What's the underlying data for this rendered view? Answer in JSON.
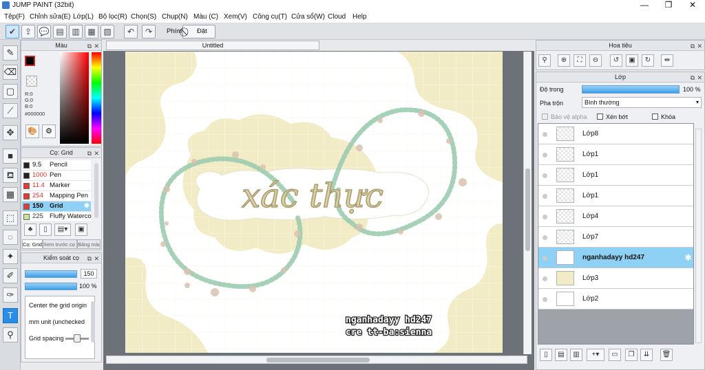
{
  "app": {
    "title": "JUMP PAINT (32bit)"
  },
  "window_controls": {
    "minimize": "—",
    "maximize": "❐",
    "close": "✕"
  },
  "menu": [
    "Tệp(F)",
    "Chỉnh sửa(E)",
    "Lớp(L)",
    "Bộ lọc(R)",
    "Chọn(S)",
    "Chụp(N)",
    "Màu (C)",
    "Xem(V)",
    "Công cụ(T)",
    "Cửa sổ(W)",
    "Cloud",
    "Help"
  ],
  "toolbar": {
    "shortcut_label": "Phím",
    "reset_label": "Đặt lại"
  },
  "color_panel": {
    "title": "Màu",
    "r": "R:0",
    "g": "G:0",
    "b": "B:0",
    "hex": "#000000"
  },
  "brush_panel": {
    "title": "Cọ: Grid",
    "brushes": [
      {
        "size": "9.5",
        "name": "Pencil",
        "color": "#222222"
      },
      {
        "size": "1000",
        "name": "Pen",
        "color": "#222222"
      },
      {
        "size": "11.4",
        "name": "Marker",
        "color": "#e53935"
      },
      {
        "size": "254",
        "name": "Mapping Pen",
        "color": "#e53935"
      },
      {
        "size": "150",
        "name": "Grid",
        "color": "#e53935"
      },
      {
        "size": "225",
        "name": "Fluffy Waterco",
        "color": "#c6e59a"
      }
    ],
    "tabs": [
      "Cọ: Grid",
      "Xem trước cọ",
      "Bảng màu"
    ]
  },
  "brush_control": {
    "title": "Kiểm soát cọ",
    "size_value": "150",
    "opacity_value": "100 %",
    "options": [
      "Center the grid origin",
      "mm unit (unchecked",
      "Grid spacing"
    ]
  },
  "document": {
    "tab": "Untitled",
    "headline": "xác thực",
    "signature_line1": "nganhadayy hd247",
    "signature_line2": "cre tt-ba:sienna"
  },
  "navigator": {
    "title": "Hoa tiêu"
  },
  "layers_panel": {
    "title": "Lớp",
    "opacity_label": "Độ trong",
    "opacity_value": "100 %",
    "opacity_fraction": 1.0,
    "blend_label": "Pha trộn",
    "blend_value": "Bình thường",
    "protect_alpha": "Bảo vệ alpha",
    "clipping": "Xén bớt",
    "lock": "Khóa",
    "layers": [
      {
        "name": "Lớp8",
        "selected": false
      },
      {
        "name": "Lớp1",
        "selected": false
      },
      {
        "name": "Lớp1",
        "selected": false
      },
      {
        "name": "Lớp1",
        "selected": false
      },
      {
        "name": "Lớp4",
        "selected": false
      },
      {
        "name": "Lớp7",
        "selected": false
      },
      {
        "name": "nganhadayy hd247",
        "selected": true
      },
      {
        "name": "Lớp3",
        "selected": false
      },
      {
        "name": "Lớp2",
        "selected": false
      }
    ]
  },
  "colors": {
    "accent": "#2a8ee6",
    "selection": "#8fd0f5",
    "cream": "#f1ebc6",
    "wreath": "#9dcbb0",
    "lettering": "#c9b98a"
  }
}
